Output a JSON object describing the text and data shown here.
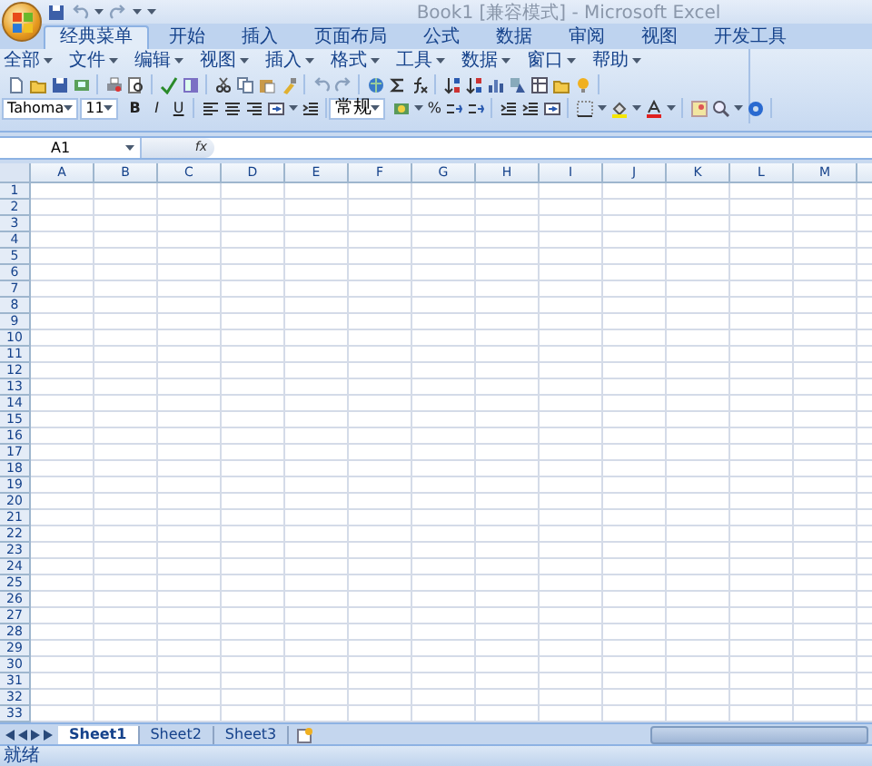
{
  "window": {
    "title": "Book1  [兼容模式] - Microsoft Excel"
  },
  "ribbon_tabs": [
    {
      "label": "经典菜单",
      "selected": true
    },
    {
      "label": "开始",
      "selected": false
    },
    {
      "label": "插入",
      "selected": false
    },
    {
      "label": "页面布局",
      "selected": false
    },
    {
      "label": "公式",
      "selected": false
    },
    {
      "label": "数据",
      "selected": false
    },
    {
      "label": "审阅",
      "selected": false
    },
    {
      "label": "视图",
      "selected": false
    },
    {
      "label": "开发工具",
      "selected": false
    }
  ],
  "menu": [
    "全部",
    "文件",
    "编辑",
    "视图",
    "插入",
    "格式",
    "工具",
    "数据",
    "窗口",
    "帮助"
  ],
  "formatting": {
    "font": "Tahoma",
    "size": "11",
    "style_buttons": [
      "B",
      "I",
      "U"
    ],
    "number_format": "常规",
    "percent": "%"
  },
  "formula_bar": {
    "name_box": "A1",
    "function_label": "fx"
  },
  "columns": [
    "A",
    "B",
    "C",
    "D",
    "E",
    "F",
    "G",
    "H",
    "I",
    "J",
    "K",
    "L",
    "M"
  ],
  "rows": [
    "1",
    "2",
    "3",
    "4",
    "5",
    "6",
    "7",
    "8",
    "9",
    "10",
    "11",
    "12",
    "13",
    "14",
    "15",
    "16",
    "17",
    "18",
    "19",
    "20",
    "21",
    "22",
    "23",
    "24",
    "25",
    "26",
    "27",
    "28",
    "29",
    "30",
    "31",
    "32",
    "33"
  ],
  "sheets": [
    {
      "label": "Sheet1",
      "selected": true
    },
    {
      "label": "Sheet2",
      "selected": false
    },
    {
      "label": "Sheet3",
      "selected": false
    }
  ],
  "status_bar": {
    "text": "就绪"
  }
}
